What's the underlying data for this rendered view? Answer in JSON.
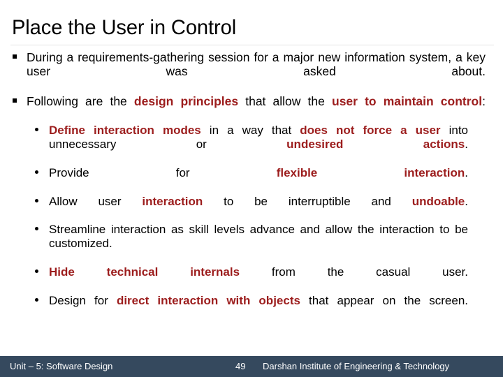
{
  "slide": {
    "title": "Place the User in Control",
    "accent_red": "#9c1d1d",
    "footer_bg": "#35495e",
    "body_text_color": "#000000"
  },
  "bullets": [
    {
      "level": 1,
      "marker": "square-bullet",
      "runs": [
        {
          "text": "During a requirements-gathering session for a major new information system, a key user was asked about.",
          "style": "black"
        }
      ]
    },
    {
      "level": 1,
      "marker": "square-bullet",
      "runs": [
        {
          "text": "Following are the ",
          "style": "black"
        },
        {
          "text": "design principles",
          "style": "red"
        },
        {
          "text": " that allow the ",
          "style": "black"
        },
        {
          "text": "user to maintain control",
          "style": "red"
        },
        {
          "text": ":",
          "style": "black"
        }
      ],
      "children": [
        {
          "level": 2,
          "marker": "round-bullet",
          "runs": [
            {
              "text": "Define interaction modes",
              "style": "red"
            },
            {
              "text": " in a way that ",
              "style": "black"
            },
            {
              "text": "does not force a user",
              "style": "red"
            },
            {
              "text": " into unnecessary or ",
              "style": "black"
            },
            {
              "text": "undesired actions",
              "style": "red"
            },
            {
              "text": ".",
              "style": "black"
            }
          ]
        },
        {
          "level": 2,
          "marker": "round-bullet",
          "runs": [
            {
              "text": "Provide for ",
              "style": "black"
            },
            {
              "text": "flexible interaction",
              "style": "red"
            },
            {
              "text": ".",
              "style": "black"
            }
          ]
        },
        {
          "level": 2,
          "marker": "round-bullet",
          "runs": [
            {
              "text": "Allow user ",
              "style": "black"
            },
            {
              "text": "interaction",
              "style": "red"
            },
            {
              "text": " to be interruptible and ",
              "style": "black"
            },
            {
              "text": "undoable",
              "style": "red"
            },
            {
              "text": ".",
              "style": "black"
            }
          ]
        },
        {
          "level": 2,
          "marker": "round-bullet",
          "runs": [
            {
              "text": "Streamline interaction as skill levels advance and allow the interaction to be customized.",
              "style": "black"
            }
          ]
        },
        {
          "level": 2,
          "marker": "round-bullet",
          "runs": [
            {
              "text": "Hide technical internals",
              "style": "red"
            },
            {
              "text": " from the casual user.",
              "style": "black"
            }
          ]
        },
        {
          "level": 2,
          "marker": "round-bullet",
          "runs": [
            {
              "text": "Design for ",
              "style": "black"
            },
            {
              "text": "direct interaction with objects",
              "style": "red"
            },
            {
              "text": " that appear on the screen.",
              "style": "black"
            }
          ]
        }
      ]
    }
  ],
  "footer": {
    "unit_label": "Unit – 5: Software Design",
    "slide_number": "49",
    "institute": "Darshan Institute of Engineering & Technology"
  }
}
